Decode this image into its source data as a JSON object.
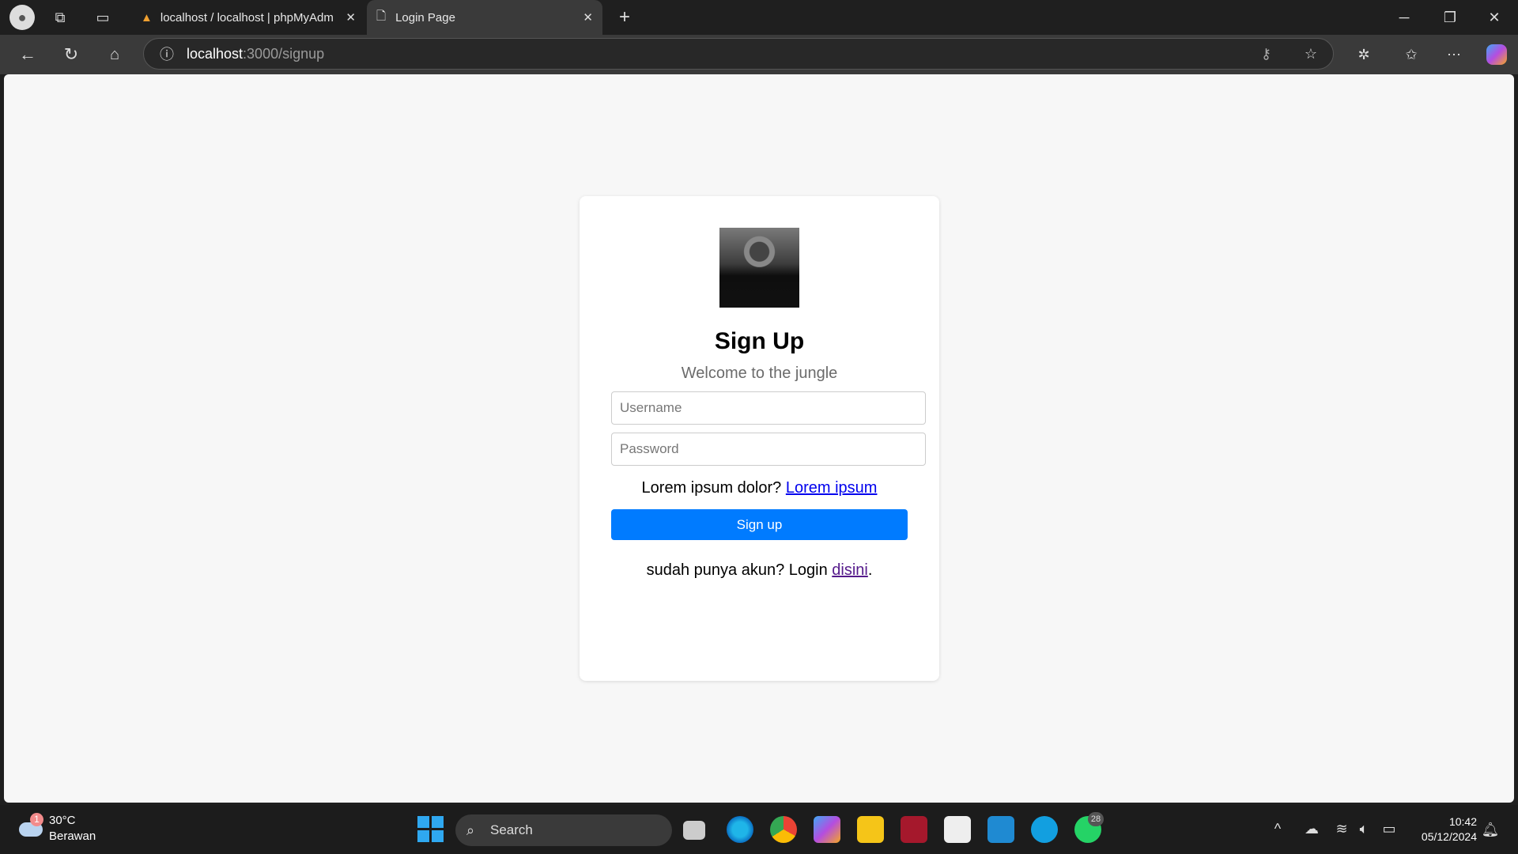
{
  "browser": {
    "tabs": [
      {
        "title": "localhost / localhost | phpMyAdm",
        "active": false
      },
      {
        "title": "Login Page",
        "active": true
      }
    ],
    "url_host": "localhost",
    "url_path": ":3000/signup"
  },
  "page": {
    "title": "Sign Up",
    "subtitle": "Welcome to the jungle",
    "username_placeholder": "Username",
    "password_placeholder": "Password",
    "lorem_text": "Lorem ipsum dolor? ",
    "lorem_link": "Lorem ipsum",
    "signup_button": "Sign up",
    "login_text": "sudah punya akun? Login ",
    "login_link": "disini",
    "login_suffix": "."
  },
  "taskbar": {
    "weather_temp": "30°C",
    "weather_desc": "Berawan",
    "weather_badge": "1",
    "search_label": "Search",
    "whatsapp_badge": "28",
    "time": "10:42",
    "date": "05/12/2024"
  },
  "colors": {
    "accent": "#007bff"
  }
}
